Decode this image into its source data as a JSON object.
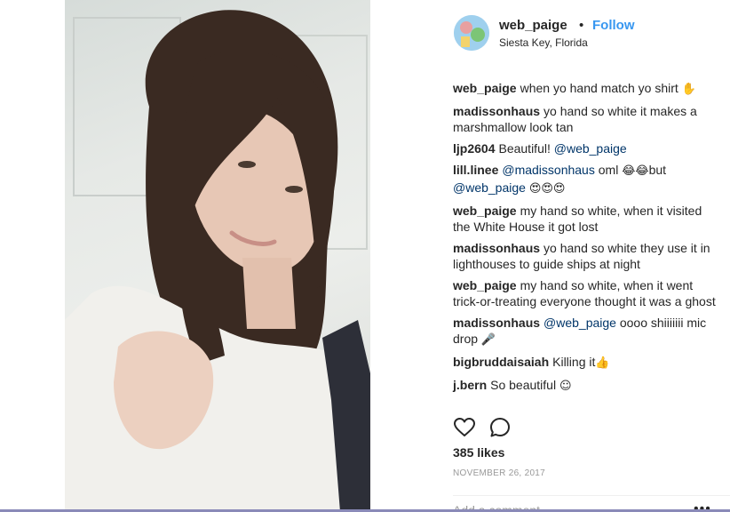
{
  "post": {
    "username": "web_paige",
    "separator": "•",
    "follow_label": "Follow",
    "location": "Siesta Key, Florida"
  },
  "comments": [
    {
      "author": "web_paige",
      "parts": [
        {
          "t": "when yo hand match yo shirt "
        },
        {
          "t": "✋",
          "e": true
        }
      ]
    },
    {
      "author": "madissonhaus",
      "parts": [
        {
          "t": "yo hand so white it makes a marshmallow look tan"
        }
      ]
    },
    {
      "author": "ljp2604",
      "parts": [
        {
          "t": "Beautiful! "
        },
        {
          "t": "@web_paige",
          "m": true
        }
      ]
    },
    {
      "author": "lill.linee",
      "parts": [
        {
          "t": "@madissonhaus",
          "m": true
        },
        {
          "t": " oml "
        },
        {
          "t": "😂😂",
          "e": true
        },
        {
          "t": "but "
        },
        {
          "t": "@web_paige",
          "m": true
        },
        {
          "t": " "
        },
        {
          "t": "😍😍😍",
          "e": true
        }
      ]
    },
    {
      "author": "web_paige",
      "parts": [
        {
          "t": "my hand so white, when it visited the White House it got lost"
        }
      ]
    },
    {
      "author": "madissonhaus",
      "parts": [
        {
          "t": "yo hand so white they use it in lighthouses to guide ships at night"
        }
      ]
    },
    {
      "author": "web_paige",
      "parts": [
        {
          "t": "my hand so white, when it went trick-or-treating everyone thought it was a ghost"
        }
      ]
    },
    {
      "author": "madissonhaus",
      "parts": [
        {
          "t": "@web_paige",
          "m": true
        },
        {
          "t": " oooo shiiiiiii mic drop "
        },
        {
          "t": "🎤",
          "e": true
        }
      ]
    },
    {
      "author": "bigbruddaisaiah",
      "parts": [
        {
          "t": "Killing it"
        },
        {
          "t": "👍",
          "e": true
        }
      ]
    },
    {
      "author": "j.bern",
      "parts": [
        {
          "t": "So beautiful "
        },
        {
          "t": "☺",
          "e": true
        }
      ]
    }
  ],
  "icons": {
    "like": "heart-icon",
    "comment": "comment-bubble-icon"
  },
  "stats": {
    "likes": "385 likes",
    "date": "NOVEMBER 26, 2017"
  },
  "add_comment": {
    "placeholder": "Add a comment...",
    "more": "•••"
  },
  "colors": {
    "follow": "#3897f0",
    "mention": "#003569",
    "text": "#262626",
    "muted": "#999999"
  }
}
